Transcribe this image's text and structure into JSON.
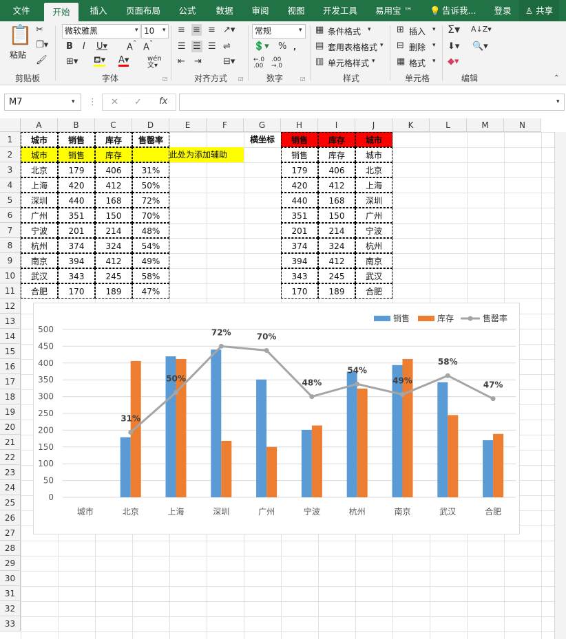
{
  "tabs": [
    "文件",
    "开始",
    "插入",
    "页面布局",
    "公式",
    "数据",
    "审阅",
    "视图",
    "开发工具",
    "易用宝 ™"
  ],
  "tell_me": "告诉我...",
  "login": "登录",
  "share": "共享",
  "ribbon": {
    "paste": "粘贴",
    "font_name": "微软雅黑",
    "font_size": "10",
    "number_format": "常规",
    "cond_format": "条件格式",
    "table_format": "套用表格格式",
    "cell_style": "单元格样式",
    "insert": "插入",
    "delete": "删除",
    "format": "格式",
    "groups": [
      "剪贴板",
      "字体",
      "对齐方式",
      "数字",
      "样式",
      "单元格",
      "编辑"
    ]
  },
  "name_box": "M7",
  "formula": "",
  "columns": [
    "A",
    "B",
    "C",
    "D",
    "E",
    "F",
    "G",
    "H",
    "I",
    "J",
    "K",
    "L",
    "M",
    "N"
  ],
  "rows": [
    "1",
    "2",
    "3",
    "4",
    "5",
    "6",
    "7",
    "8",
    "9",
    "10",
    "11",
    "12",
    "13",
    "14",
    "15",
    "16",
    "17",
    "18",
    "19",
    "20",
    "21",
    "22",
    "23",
    "24",
    "25",
    "26",
    "27",
    "28",
    "29",
    "30",
    "31",
    "32",
    "33"
  ],
  "left_headers": [
    "城市",
    "销售",
    "库存",
    "售罄率"
  ],
  "helper_row": [
    "城市",
    "销售",
    "库存",
    ""
  ],
  "helper_note": "此处为添加辅助",
  "axis_label": "横坐标",
  "right_headers": [
    "销售",
    "库存",
    "城市"
  ],
  "right_helper": [
    "销售",
    "库存",
    "城市"
  ],
  "table": [
    [
      "北京",
      "179",
      "406",
      "31%"
    ],
    [
      "上海",
      "420",
      "412",
      "50%"
    ],
    [
      "深圳",
      "440",
      "168",
      "72%"
    ],
    [
      "广州",
      "351",
      "150",
      "70%"
    ],
    [
      "宁波",
      "201",
      "214",
      "48%"
    ],
    [
      "杭州",
      "374",
      "324",
      "54%"
    ],
    [
      "南京",
      "394",
      "412",
      "49%"
    ],
    [
      "武汉",
      "343",
      "245",
      "58%"
    ],
    [
      "合肥",
      "170",
      "189",
      "47%"
    ]
  ],
  "colors": {
    "green": "#217346",
    "blue": "#5b9bd5",
    "orange": "#ed7d31",
    "gray": "#a5a5a5",
    "yellow": "#ffff00",
    "red": "#ff0000"
  },
  "chart_data": {
    "type": "bar",
    "categories": [
      "城市",
      "北京",
      "上海",
      "深圳",
      "广州",
      "宁波",
      "杭州",
      "南京",
      "武汉",
      "合肥"
    ],
    "series": [
      {
        "name": "销售",
        "type": "bar",
        "values": [
          null,
          179,
          420,
          440,
          351,
          201,
          374,
          394,
          343,
          170
        ]
      },
      {
        "name": "库存",
        "type": "bar",
        "values": [
          null,
          406,
          412,
          168,
          150,
          214,
          324,
          412,
          245,
          189
        ]
      },
      {
        "name": "售罄率",
        "type": "line",
        "values": [
          null,
          0.31,
          0.5,
          0.72,
          0.7,
          0.48,
          0.54,
          0.49,
          0.58,
          0.47
        ],
        "labels": [
          "",
          "31%",
          "50%",
          "72%",
          "70%",
          "48%",
          "54%",
          "49%",
          "58%",
          "47%"
        ]
      }
    ],
    "ylim": [
      0,
      500
    ],
    "yticks": [
      "500",
      "450",
      "400",
      "350",
      "300",
      "250",
      "200",
      "150",
      "100",
      "50",
      "0"
    ],
    "legend": "top-right"
  }
}
